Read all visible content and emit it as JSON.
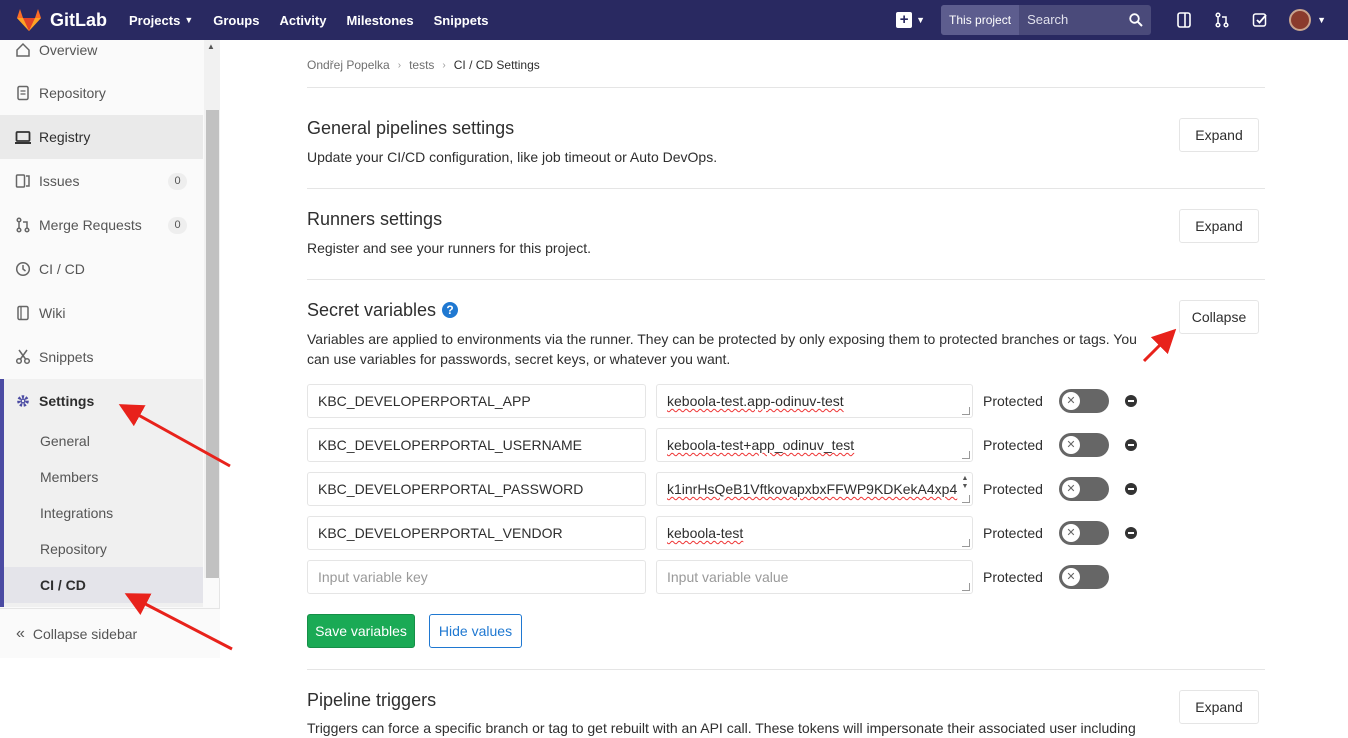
{
  "navbar": {
    "brand": "GitLab",
    "links": [
      {
        "label": "Projects",
        "caret": true
      },
      {
        "label": "Groups",
        "caret": false
      },
      {
        "label": "Activity",
        "caret": false
      },
      {
        "label": "Milestones",
        "caret": false
      },
      {
        "label": "Snippets",
        "caret": false
      }
    ],
    "search_scope": "This project",
    "search_placeholder": "Search",
    "colors": {
      "bg": "#292961",
      "accent": "#fc6d26"
    }
  },
  "sidebar": {
    "items": [
      {
        "label": "Overview",
        "icon": "home-icon"
      },
      {
        "label": "Repository",
        "icon": "doc-icon"
      },
      {
        "label": "Registry",
        "icon": "laptop-icon"
      },
      {
        "label": "Issues",
        "icon": "issues-icon",
        "badge": "0"
      },
      {
        "label": "Merge Requests",
        "icon": "merge-icon",
        "badge": "0"
      },
      {
        "label": "CI / CD",
        "icon": "cicd-icon"
      },
      {
        "label": "Wiki",
        "icon": "book-icon"
      },
      {
        "label": "Snippets",
        "icon": "scissors-icon"
      },
      {
        "label": "Settings",
        "icon": "gear-icon"
      }
    ],
    "settings_sub": [
      "General",
      "Members",
      "Integrations",
      "Repository",
      "CI / CD"
    ],
    "collapse_label": "Collapse sidebar"
  },
  "breadcrumb": [
    "Ondřej Popelka",
    "tests",
    "CI / CD Settings"
  ],
  "sections": {
    "general": {
      "title": "General pipelines settings",
      "desc": "Update your CI/CD configuration, like job timeout or Auto DevOps.",
      "button": "Expand"
    },
    "runners": {
      "title": "Runners settings",
      "desc": "Register and see your runners for this project.",
      "button": "Expand"
    },
    "secret": {
      "title": "Secret variables",
      "desc1": "Variables are applied to environments via the runner. They can be protected by only exposing them to protected branches or tags. You",
      "desc2": "can use variables for passwords, secret keys, or whatever you want.",
      "button": "Collapse",
      "protected_label": "Protected",
      "variables": [
        {
          "key": "KBC_DEVELOPERPORTAL_APP",
          "value": "keboola-test.app-odinuv-test"
        },
        {
          "key": "KBC_DEVELOPERPORTAL_USERNAME",
          "value": "keboola-test+app_odinuv_test"
        },
        {
          "key": "KBC_DEVELOPERPORTAL_PASSWORD",
          "value": "k1inrHsQeB1VftkovapxbxFFWP9KDKekA4xp4"
        },
        {
          "key": "KBC_DEVELOPERPORTAL_VENDOR",
          "value": "keboola-test"
        }
      ],
      "new_key_placeholder": "Input variable key",
      "new_value_placeholder": "Input variable value",
      "save_button": "Save variables",
      "hide_button": "Hide values"
    },
    "triggers": {
      "title": "Pipeline triggers",
      "desc": "Triggers can force a specific branch or tag to get rebuilt with an API call. These tokens will impersonate their associated user including",
      "button": "Expand"
    }
  }
}
